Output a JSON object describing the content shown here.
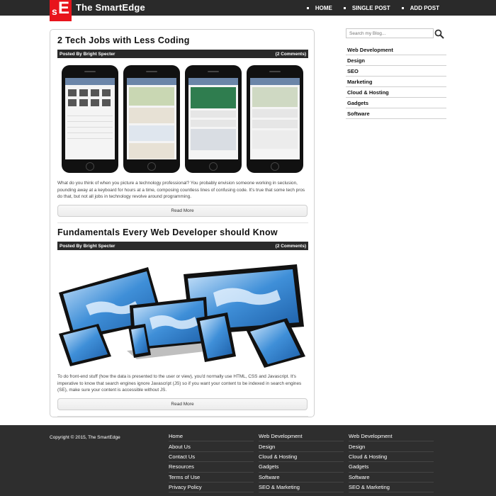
{
  "header": {
    "logo_s": "s",
    "logo_e": "E",
    "site_title": "The SmartEdge",
    "nav": [
      "HOME",
      "SINGLE POST",
      "ADD POST"
    ]
  },
  "posts": [
    {
      "title": "2 Tech Jobs with Less Coding",
      "author": "Posted By Bright Specter",
      "comments": "(2 Comments)",
      "excerpt": "What do you think of when you picture a technology professional? You probably envision someone working in seclusion, pounding away at a keyboard for hours at a time, composing countless lines of confusing code. It’s true that some tech pros do that, but not all jobs in technology revolve around programming.",
      "read_more": "Read More"
    },
    {
      "title": "Fundamentals Every Web Developer should Know",
      "author": "Posted By Bright Specter",
      "comments": "(2 Comments)",
      "excerpt": "To do front-end stuff (how the data is presented to the user or view), you'd normally use HTML, CSS and Javascript. It's imperative to know that search engines ignore Javascript (JS) so if you want your content to be indexed in search engines (SE), make sure your content is accessible without JS.",
      "read_more": "Read More"
    }
  ],
  "sidebar": {
    "search_placeholder": "Search my Blog...",
    "categories": [
      "Web Development",
      "Design",
      "SEO",
      "Marketing",
      "Cloud & Hosting",
      "Gadgets",
      "Software"
    ]
  },
  "footer": {
    "copyright": "Copyright © 2015, The SmartEdge",
    "col1": [
      "Home",
      "About Us",
      "Contact Us",
      "Resources",
      "Terms of Use",
      "Privacy Policy"
    ],
    "col2": [
      "Web Development",
      "Design",
      "Cloud & Hosting",
      "Gadgets",
      "Software",
      "SEO & Marketing"
    ],
    "col3": [
      "Web Development",
      "Design",
      "Cloud & Hosting",
      "Gadgets",
      "Software",
      "SEO & Marketing"
    ]
  },
  "colors": {
    "topbar": "#2a2a2a",
    "logo": "#e8141c",
    "footer": "#2e2e2e"
  }
}
